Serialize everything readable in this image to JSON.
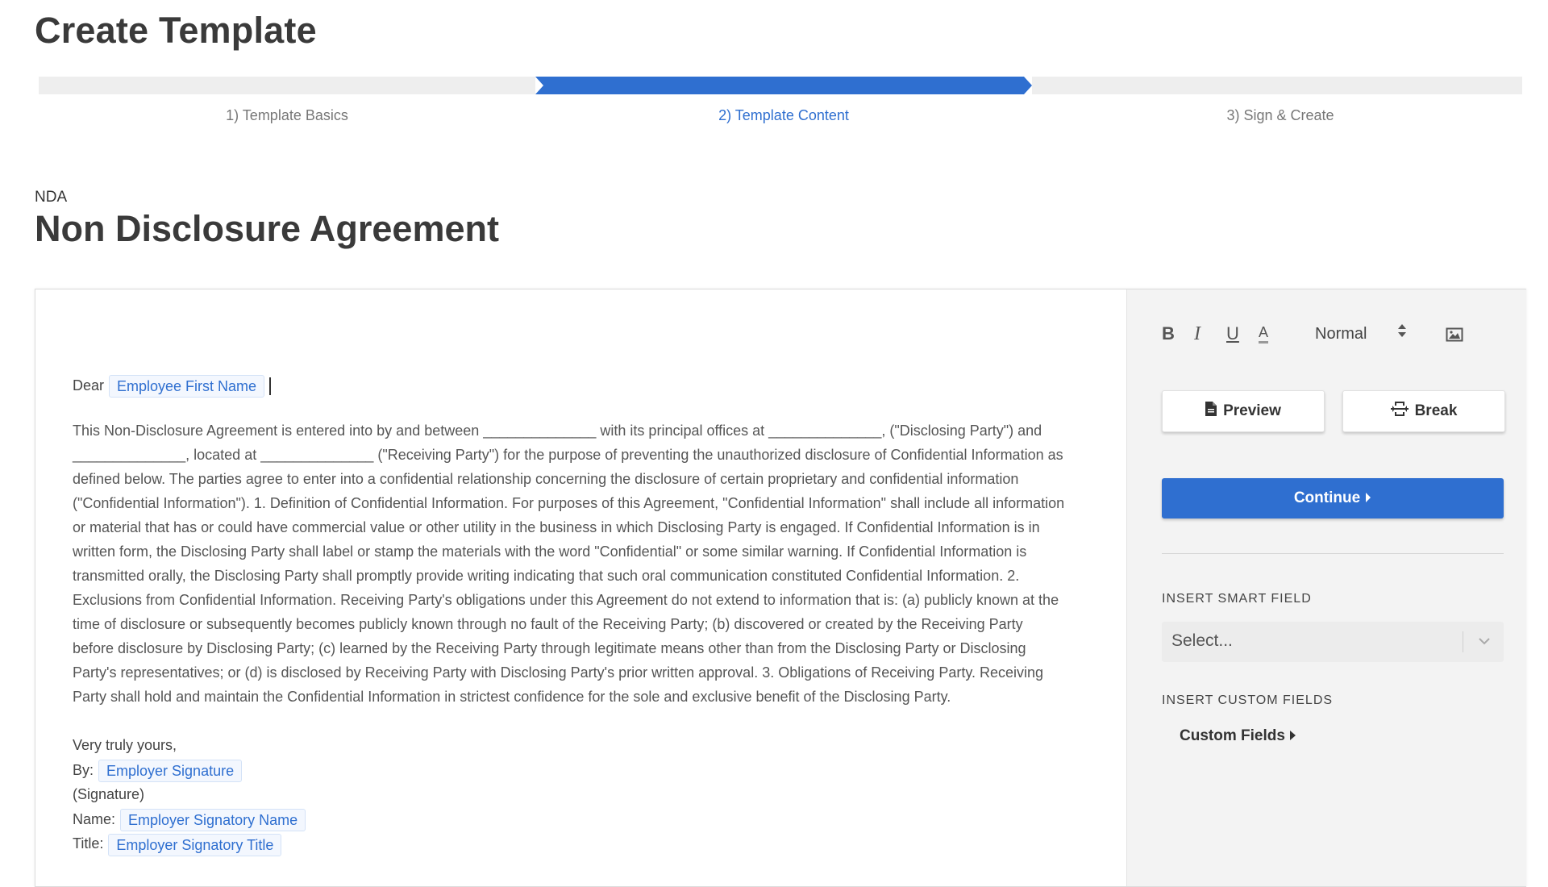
{
  "page": {
    "title": "Create Template"
  },
  "steps": [
    {
      "label": "1) Template Basics"
    },
    {
      "label": "2) Template Content"
    },
    {
      "label": "3) Sign & Create"
    }
  ],
  "document": {
    "abbrev": "NDA",
    "title": "Non Disclosure Agreement"
  },
  "editor": {
    "greeting": "Dear",
    "greeting_field": "Employee First Name",
    "body_lines": [
      "This Non-Disclosure Agreement is entered into by and between ______________ with its principal offices at ______________, (\"Disclosing Party\") and",
      "______________, located at ______________ (\"Receiving Party\") for the purpose of preventing the unauthorized disclosure of Confidential Information as",
      "defined below. The parties agree to enter into a confidential relationship concerning the disclosure of certain proprietary and confidential information",
      "(\"Confidential Information\"). 1. Definition of Confidential Information. For purposes of this Agreement, \"Confidential Information\" shall include all information",
      "or material that has or could have commercial value or other utility in the business in which Disclosing Party is engaged. If Confidential Information is in",
      "written form, the Disclosing Party shall label or stamp the materials with the word \"Confidential\" or some similar warning. If Confidential Information is",
      "transmitted orally, the Disclosing Party shall promptly provide writing indicating that such oral communication constituted Confidential Information. 2.",
      "Exclusions from Confidential Information. Receiving Party's obligations under this Agreement do not extend to information that is: (a) publicly known at the",
      "time of disclosure or subsequently becomes publicly known through no fault of the Receiving Party; (b) discovered or created by the Receiving Party",
      "before disclosure by Disclosing Party; (c) learned by the Receiving Party through legitimate means other than from the Disclosing Party or Disclosing",
      "Party's representatives; or (d) is disclosed by Receiving Party with Disclosing Party's prior written approval. 3. Obligations of Receiving Party. Receiving",
      "Party shall hold and maintain the Confidential Information in strictest confidence for the sole and exclusive benefit of the Disclosing Party."
    ],
    "closing": "Very truly yours,",
    "by_label": "By:",
    "by_field": "Employer Signature",
    "signature_note": "(Signature)",
    "name_label": "Name:",
    "name_field": "Employer Signatory Name",
    "title_label": "Title:",
    "title_field": "Employer Signatory Title"
  },
  "toolbar": {
    "bold": "B",
    "italic": "I",
    "underline": "U",
    "color": "A",
    "size": "Normal",
    "icons": {
      "size_arrows": "updown-arrows-icon",
      "image": "image-icon"
    }
  },
  "actions": {
    "preview": "Preview",
    "break": "Break",
    "continue": "Continue"
  },
  "smart_field": {
    "label": "INSERT SMART FIELD",
    "placeholder": "Select..."
  },
  "custom_fields": {
    "label": "INSERT CUSTOM FIELDS",
    "link": "Custom Fields"
  },
  "colors": {
    "accent": "#2f6fd0",
    "chip_bg": "#f3f7fe",
    "sidebar_bg": "#f3f3f3"
  }
}
